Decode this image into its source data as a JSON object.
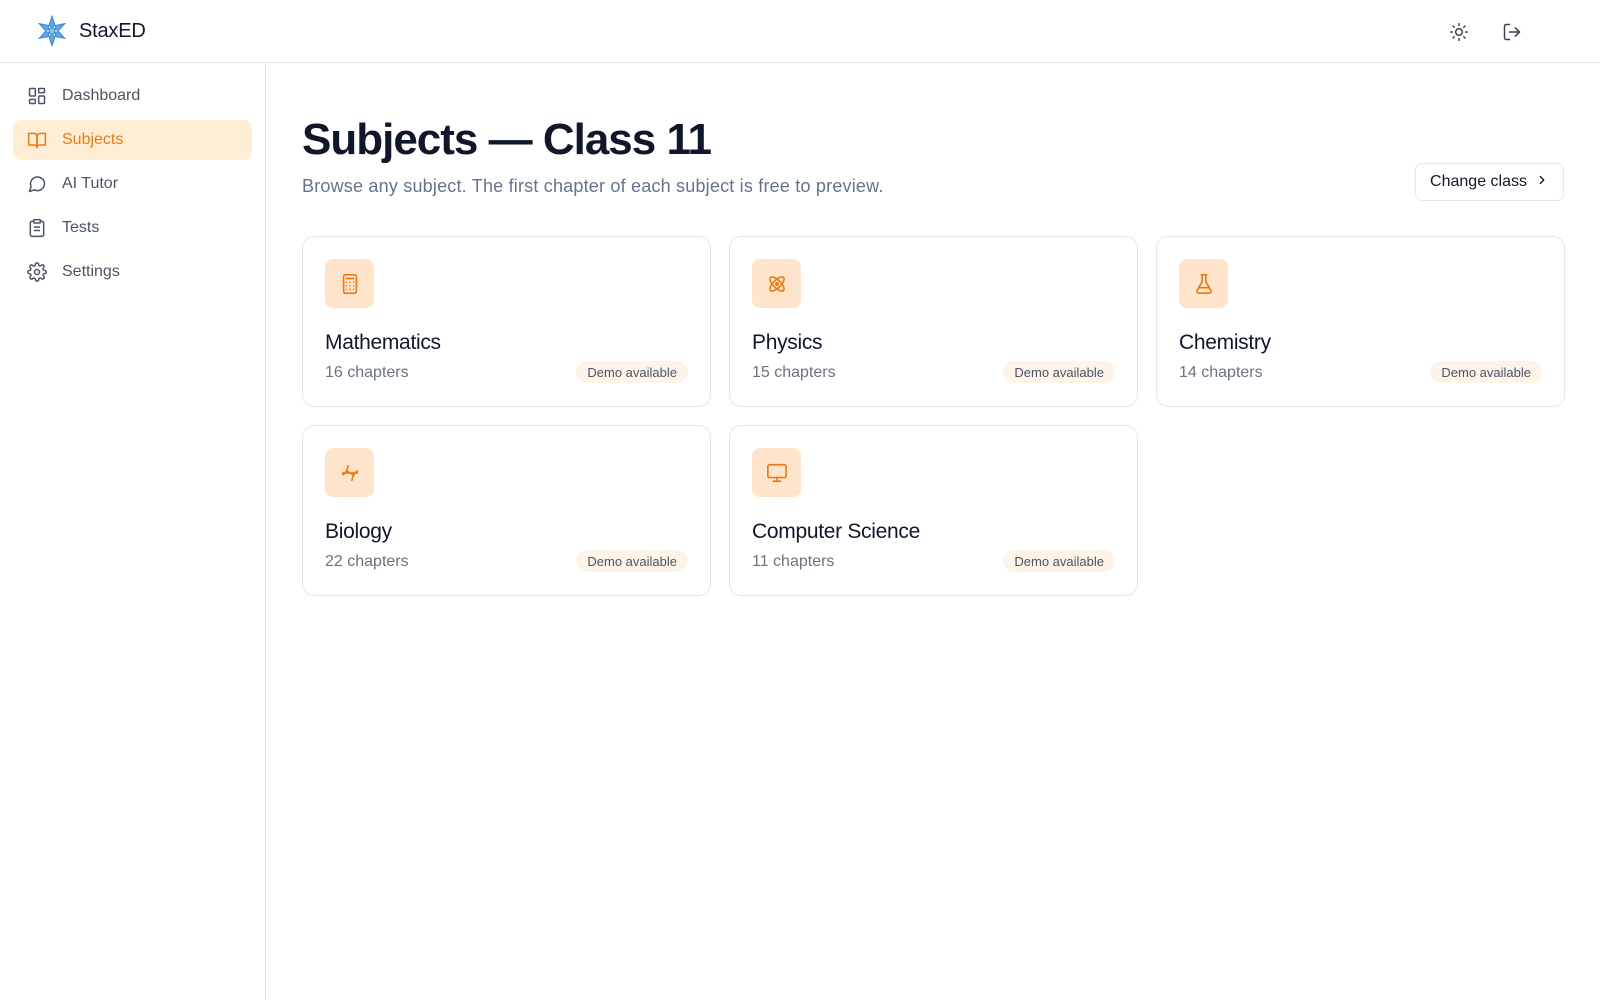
{
  "app": {
    "name": "StaxED"
  },
  "header": {
    "theme_toggle_icon": "sun-icon",
    "logout_icon": "logout-icon"
  },
  "sidebar": {
    "items": [
      {
        "label": "Dashboard",
        "icon": "dashboard-icon",
        "active": false
      },
      {
        "label": "Subjects",
        "icon": "book-icon",
        "active": true
      },
      {
        "label": "AI Tutor",
        "icon": "chat-icon",
        "active": false
      },
      {
        "label": "Tests",
        "icon": "clipboard-icon",
        "active": false
      },
      {
        "label": "Settings",
        "icon": "gear-icon",
        "active": false
      }
    ]
  },
  "main": {
    "title": "Subjects — Class 11",
    "subtitle": "Browse any subject. The first chapter of each subject is free to preview.",
    "change_class_label": "Change class"
  },
  "subjects": [
    {
      "name": "Mathematics",
      "chapters": "16 chapters",
      "badge": "Demo available",
      "icon": "calculator-icon"
    },
    {
      "name": "Physics",
      "chapters": "15 chapters",
      "badge": "Demo available",
      "icon": "atom-icon"
    },
    {
      "name": "Chemistry",
      "chapters": "14 chapters",
      "badge": "Demo available",
      "icon": "flask-icon"
    },
    {
      "name": "Biology",
      "chapters": "22 chapters",
      "badge": "Demo available",
      "icon": "dna-icon"
    },
    {
      "name": "Computer Science",
      "chapters": "11 chapters",
      "badge": "Demo available",
      "icon": "monitor-icon"
    }
  ],
  "colors": {
    "accent": "#ea7a14",
    "accent_bg": "#ffedd5",
    "icon_bg": "#ffe4cc",
    "badge_bg": "#fdf3e8",
    "border": "#e5e7eb",
    "text_primary": "#0f172a",
    "text_muted": "#64748b"
  }
}
